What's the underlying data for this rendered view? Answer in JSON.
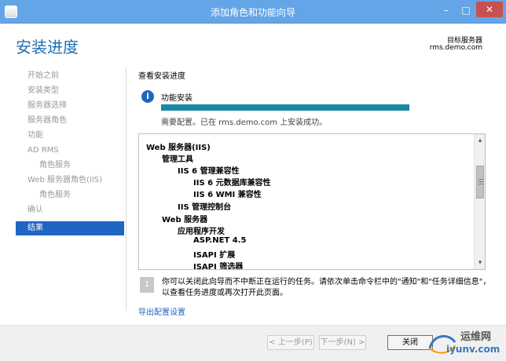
{
  "window": {
    "title": "添加角色和功能向导",
    "min_icon": "minimize-icon",
    "max_icon": "maximize-icon",
    "close_icon": "close-icon"
  },
  "header": {
    "title": "安装进度",
    "target_label": "目标服务器",
    "target_value": "rms.demo.com"
  },
  "sidebar": {
    "items": [
      {
        "label": "开始之前",
        "state": "disabled",
        "level": 0
      },
      {
        "label": "安装类型",
        "state": "disabled",
        "level": 0
      },
      {
        "label": "服务器选择",
        "state": "disabled",
        "level": 0
      },
      {
        "label": "服务器角色",
        "state": "disabled",
        "level": 0
      },
      {
        "label": "功能",
        "state": "disabled",
        "level": 0
      },
      {
        "label": "AD RMS",
        "state": "disabled",
        "level": 0
      },
      {
        "label": "角色服务",
        "state": "disabled",
        "level": 1
      },
      {
        "label": "Web 服务器角色(IIS)",
        "state": "disabled",
        "level": 0
      },
      {
        "label": "角色服务",
        "state": "disabled",
        "level": 1
      },
      {
        "label": "确认",
        "state": "disabled",
        "level": 0
      },
      {
        "label": "结果",
        "state": "active",
        "level": 0
      }
    ]
  },
  "main": {
    "section_title": "查看安装进度",
    "feature_label": "功能安装",
    "progress_percent": 100,
    "status_text": "需要配置。已在 rms.demo.com 上安装成功。",
    "tree": [
      {
        "label": "Web 服务器(IIS)",
        "level": 0
      },
      {
        "label": "管理工具",
        "level": 1
      },
      {
        "label": "IIS 6 管理兼容性",
        "level": 2
      },
      {
        "label": "IIS 6 元数据库兼容性",
        "level": 3
      },
      {
        "label": "IIS 6 WMI 兼容性",
        "level": 3
      },
      {
        "label": "IIS 管理控制台",
        "level": 2
      },
      {
        "label": "Web 服务器",
        "level": 1
      },
      {
        "label": "应用程序开发",
        "level": 2
      },
      {
        "label": "ASP.NET 4.5",
        "level": 3
      },
      {
        "label": "ISAPI 扩展",
        "level": 3
      },
      {
        "label": "ISAPI 筛选器",
        "level": 3
      }
    ],
    "note_text": "你可以关闭此向导而不中断正在运行的任务。请依次单击命令栏中的\"通知\"和\"任务详细信息\"，以查看任务进度或再次打开此页面。",
    "export_link": "导出配置设置"
  },
  "footer": {
    "prev": "< 上一步(P)",
    "next": "下一步(N) >",
    "close": "关闭"
  },
  "watermark": {
    "title": "运维网",
    "url": "iyunv.com"
  }
}
